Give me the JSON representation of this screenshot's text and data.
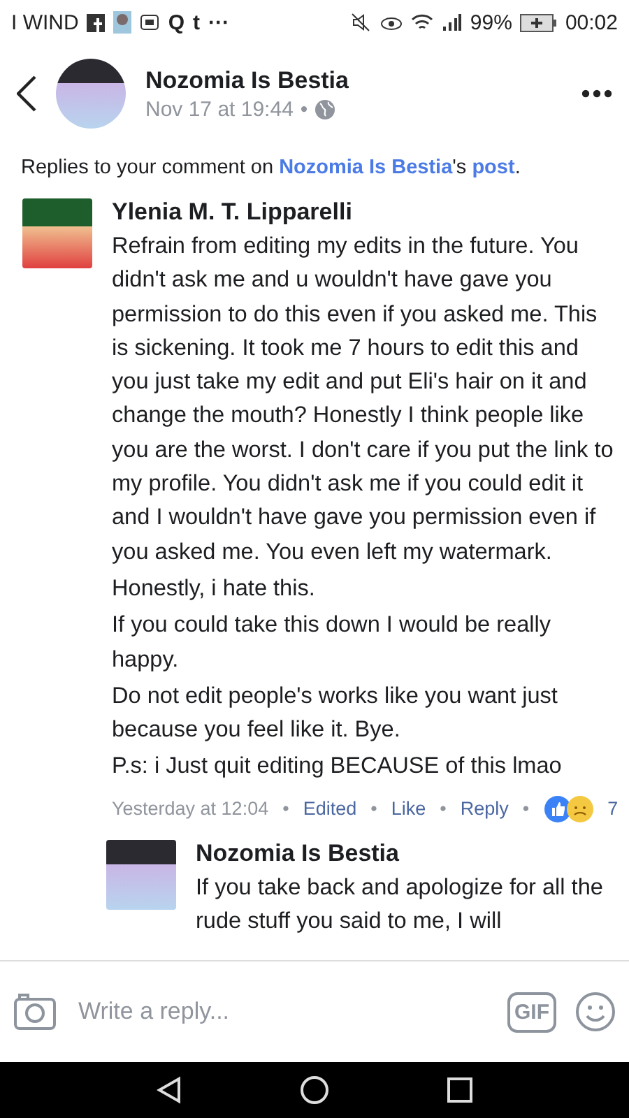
{
  "status_bar": {
    "carrier": "I WIND",
    "app_glyphs": [
      "Q",
      "t",
      "···"
    ],
    "battery": "99%",
    "time": "00:02"
  },
  "header": {
    "name": "Nozomia Is Bestia",
    "timestamp": "Nov 17 at 19:44",
    "separator": "•"
  },
  "context": {
    "prefix": "Replies to your comment on ",
    "page": "Nozomia Is Bestia",
    "middle": "'s ",
    "link": "post",
    "suffix": "."
  },
  "comment": {
    "author": "Ylenia M. T. Lipparelli",
    "paragraphs": [
      "Refrain from editing my edits in the future. You didn't ask me and u wouldn't have gave you permission to do this even if you asked me. This is sickening. It took me 7 hours to edit this and you just take my edit and put Eli's hair on it and change the mouth? Honestly I think people like you are the worst. I don't care if you put the link to my profile. You didn't ask me if you could edit it and I wouldn't have gave you permission even if you asked me. You even left my watermark.",
      "Honestly, i hate this.",
      "If you could take this down I would be really happy.",
      "Do not edit people's works like you want just because you feel like it. Bye.",
      "P.s: i Just quit editing BECAUSE of this lmao"
    ],
    "meta": {
      "time": "Yesterday at 12:04",
      "actions": [
        "Edited",
        "Like",
        "Reply"
      ],
      "separator": "•",
      "reaction_count": "7"
    }
  },
  "reply": {
    "author": "Nozomia Is Bestia",
    "text": "If you take back and apologize for all the rude stuff you said to me, I will"
  },
  "composer": {
    "placeholder": "Write a reply...",
    "gif": "GIF"
  }
}
